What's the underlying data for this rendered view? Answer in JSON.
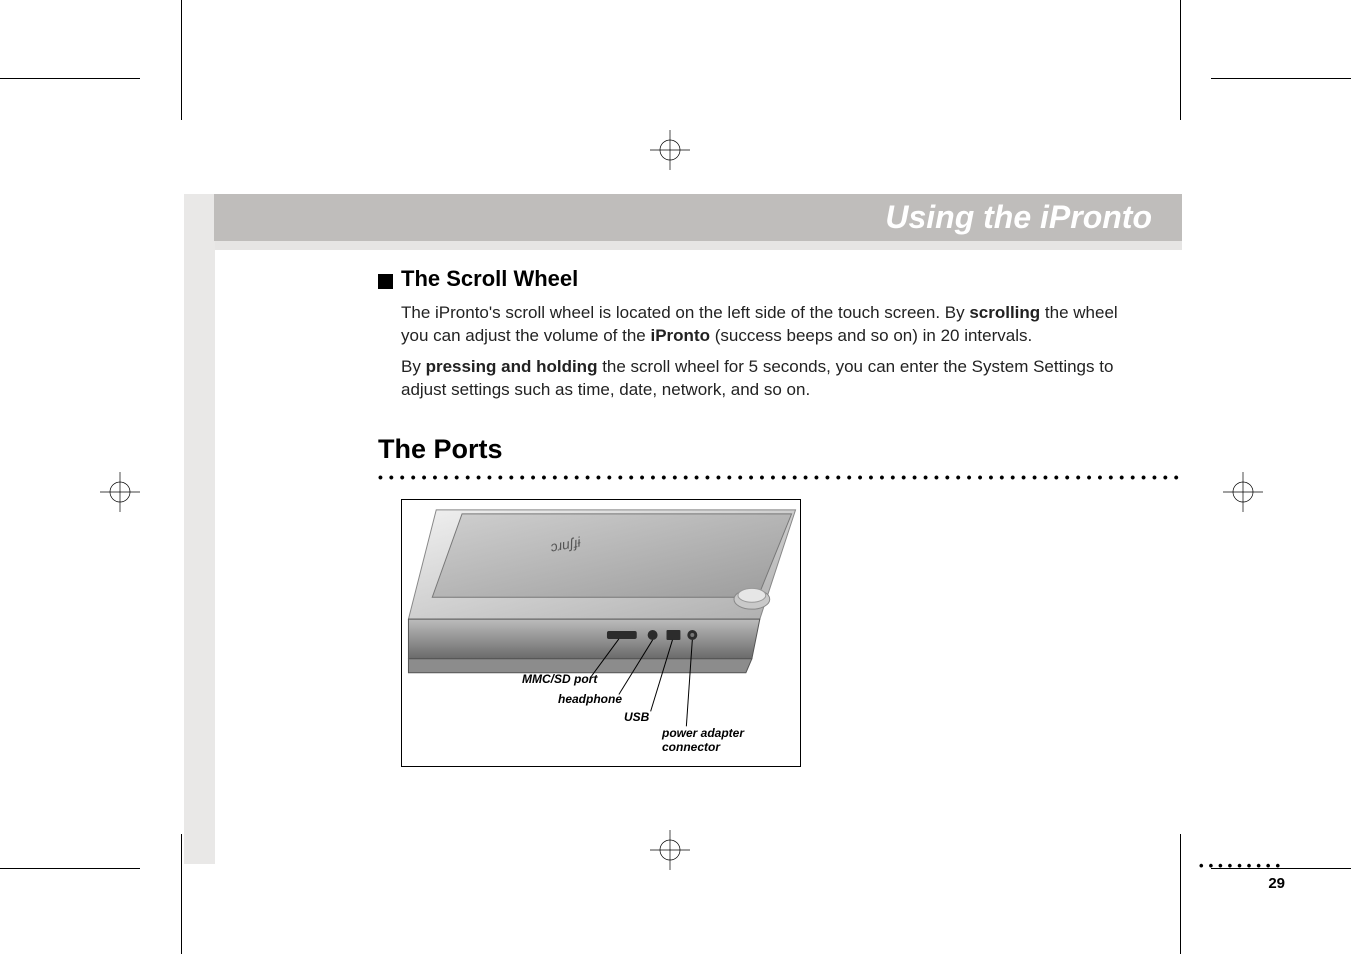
{
  "chapter_title": "Using the iPronto",
  "section": {
    "heading": "The Scroll Wheel",
    "para1_pre": "The iPronto's scroll wheel is located on the left side of the touch screen. By ",
    "para1_bold1": "scrolling",
    "para1_mid": " the wheel you can adjust the volume of the ",
    "para1_bold2": "iPronto",
    "para1_end": " (success beeps and so on) in 20 intervals.",
    "para2_pre": "By ",
    "para2_bold": "pressing and holding",
    "para2_end": " the scroll wheel for 5 seconds, you can enter the System Settings to adjust settings such as time, date, network, and so on."
  },
  "ports_heading": "The Ports",
  "figure_labels": {
    "mmc": "MMC/SD port",
    "headphone": "headphone",
    "usb": "USB",
    "power1": "power adapter",
    "power2": "connector"
  },
  "page_number": "29"
}
